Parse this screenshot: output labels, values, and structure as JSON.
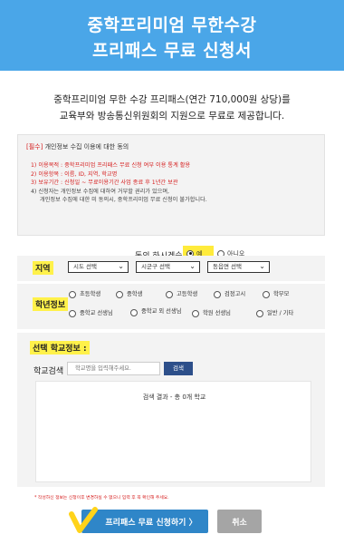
{
  "header": {
    "title_line1": "중학프리미엄 무한수강",
    "title_line2": "프리패스 무료 신청서"
  },
  "intro": {
    "line1": "중학프리미엄 무한 수강 프리패스(연간 710,000원 상당)를",
    "line2": "교육부와 방송통신위원회의 지원으로 무료로 제공합니다."
  },
  "consent": {
    "title_prefix": "[필수]",
    "title": "개인정보 수집 이용에 대한 동의",
    "items": [
      "1) 이용목적 : 중학프리미엄 프리패스 무료 신청 여부 이용 통계 활용",
      "2) 이용항목 : 이름, ID, 지역, 학교명",
      "3) 보유기간 : 신청일 ~ 무료이용기간 사업 종료 후 1년간 보관"
    ],
    "note_line1": "4) 신청자는 개인정보 수집에 대하여 거부할 권리가 있으며,",
    "note_line2": "개인정보 수집에 대한 미 동의시, 중학프리미엄 무료 신청이 불가합니다.",
    "question": "동의 하시겠습니까?",
    "yes_label": "예",
    "no_label": "아니오"
  },
  "region": {
    "label": "지역",
    "selects": [
      "시도 선택",
      "시군구 선택",
      "동읍면 선택"
    ]
  },
  "student": {
    "label": "학년정보",
    "options": [
      "초등학생",
      "중학생",
      "고등학생",
      "검정고시",
      "학부모",
      "중학교 선생님",
      "중학교 외 선생님",
      "학원 선생님",
      "일반 / 기타"
    ]
  },
  "school": {
    "label": "선택 학교정보 :",
    "search_label": "학교검색",
    "search_placeholder": "학교명을 입력해주세요.",
    "search_button": "검색",
    "results_text": "검색 결과 - 총 0개 학교"
  },
  "footer": {
    "footnote": "* 작성하신 정보는 신청이후 변경하실 수 없으니 입력 후 꼭 확인해 주세요.",
    "apply_button": "프리패스 무료 신청하기 〉",
    "cancel_button": "취소"
  },
  "colors": {
    "header_bg": "#4aa6e8",
    "highlight": "#fff14a",
    "apply_bg": "#2f86c8",
    "search_btn_bg": "#2d4f8a",
    "cancel_bg": "#a5a5a5",
    "required_red": "#d62020"
  }
}
